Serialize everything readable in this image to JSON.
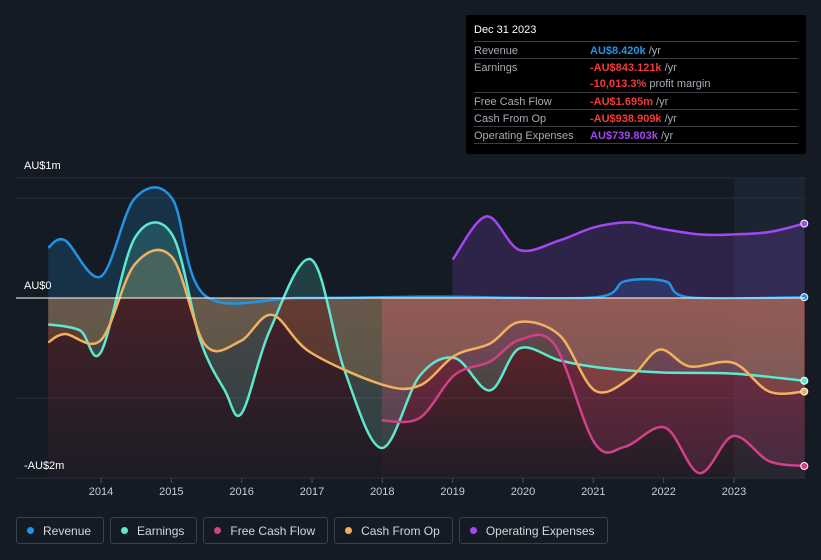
{
  "tooltip": {
    "date": "Dec 31 2023",
    "rows": [
      {
        "label": "Revenue",
        "value": "AU$8.420k",
        "unit": "/yr",
        "color": "#2394e4"
      },
      {
        "label": "Earnings",
        "value": "-AU$843.121k",
        "unit": "/yr",
        "color": "#f03b3b"
      },
      {
        "label": "",
        "value": "-10,013.3%",
        "unit": "profit margin",
        "color": "#f03b3b"
      },
      {
        "label": "Free Cash Flow",
        "value": "-AU$1.695m",
        "unit": "/yr",
        "color": "#f03b3b"
      },
      {
        "label": "Cash From Op",
        "value": "-AU$938.909k",
        "unit": "/yr",
        "color": "#f03b3b"
      },
      {
        "label": "Operating Expenses",
        "value": "AU$739.803k",
        "unit": "/yr",
        "color": "#a347f0"
      }
    ]
  },
  "legend": [
    {
      "label": "Revenue",
      "color": "#2394e4"
    },
    {
      "label": "Earnings",
      "color": "#5ee8cf"
    },
    {
      "label": "Free Cash Flow",
      "color": "#d0418a"
    },
    {
      "label": "Cash From Op",
      "color": "#f1b15f"
    },
    {
      "label": "Operating Expenses",
      "color": "#a347f0"
    }
  ],
  "chart_data": {
    "type": "line",
    "y_tick_labels": [
      "AU$1m",
      "AU$0",
      "-AU$2m"
    ],
    "x_tick_labels": [
      "2014",
      "2015",
      "2016",
      "2017",
      "2018",
      "2019",
      "2020",
      "2021",
      "2022",
      "2023"
    ],
    "xlim": [
      2013.25,
      2024.0
    ],
    "ylim_millions": [
      -1.5,
      1.0
    ],
    "grid": true,
    "legend_placement": "bottom",
    "series": [
      {
        "name": "Revenue",
        "color": "#2394e4",
        "x": [
          2013.25,
          2013.49,
          2014.0,
          2014.48,
          2015.01,
          2015.48,
          2016.83,
          2018.5,
          2019.0,
          2021.02,
          2021.45,
          2022.02,
          2022.37,
          2024.0
        ],
        "y": [
          0.42,
          0.48,
          0.18,
          0.83,
          0.83,
          0.02,
          0.0,
          0.01,
          0.01,
          0.005,
          0.14,
          0.14,
          0.005,
          0.007
        ]
      },
      {
        "name": "Earnings",
        "color": "#5ee8cf",
        "x": [
          2013.25,
          2013.7,
          2014.0,
          2014.48,
          2015.01,
          2015.41,
          2015.76,
          2016.0,
          2016.4,
          2016.99,
          2017.46,
          2017.99,
          2018.53,
          2019.03,
          2019.53,
          2019.95,
          2020.52,
          2021.09,
          2021.94,
          2022.99,
          2024.0
        ],
        "y": [
          -0.22,
          -0.27,
          -0.45,
          0.5,
          0.53,
          -0.35,
          -0.77,
          -0.96,
          -0.27,
          0.32,
          -0.6,
          -1.25,
          -0.65,
          -0.5,
          -0.77,
          -0.42,
          -0.52,
          -0.58,
          -0.62,
          -0.63,
          -0.69
        ]
      },
      {
        "name": "Free Cash Flow",
        "color": "#d0418a",
        "x": [
          2017.99,
          2018.53,
          2019.03,
          2019.53,
          2019.95,
          2020.45,
          2021.02,
          2021.45,
          2022.02,
          2022.51,
          2022.99,
          2023.5,
          2024.0
        ],
        "y": [
          -1.02,
          -1.0,
          -0.64,
          -0.53,
          -0.35,
          -0.39,
          -1.21,
          -1.24,
          -1.08,
          -1.46,
          -1.15,
          -1.36,
          -1.4
        ]
      },
      {
        "name": "Cash From Op",
        "color": "#f1b15f",
        "x": [
          2013.25,
          2013.49,
          2014.0,
          2014.48,
          2015.01,
          2015.48,
          2015.98,
          2016.43,
          2016.97,
          2017.99,
          2018.53,
          2019.03,
          2019.53,
          2019.95,
          2020.52,
          2021.02,
          2021.52,
          2021.94,
          2022.37,
          2022.99,
          2023.5,
          2024.0
        ],
        "y": [
          -0.37,
          -0.3,
          -0.35,
          0.28,
          0.34,
          -0.39,
          -0.36,
          -0.14,
          -0.45,
          -0.72,
          -0.73,
          -0.48,
          -0.38,
          -0.2,
          -0.31,
          -0.77,
          -0.67,
          -0.43,
          -0.57,
          -0.54,
          -0.78,
          -0.78
        ]
      },
      {
        "name": "Operating Expenses",
        "color": "#a347f0",
        "x": [
          2019.0,
          2019.48,
          2019.95,
          2020.52,
          2021.02,
          2021.52,
          2021.94,
          2022.51,
          2022.99,
          2023.5,
          2024.0
        ],
        "y": [
          0.32,
          0.68,
          0.4,
          0.48,
          0.59,
          0.63,
          0.58,
          0.53,
          0.53,
          0.55,
          0.62
        ]
      }
    ]
  }
}
